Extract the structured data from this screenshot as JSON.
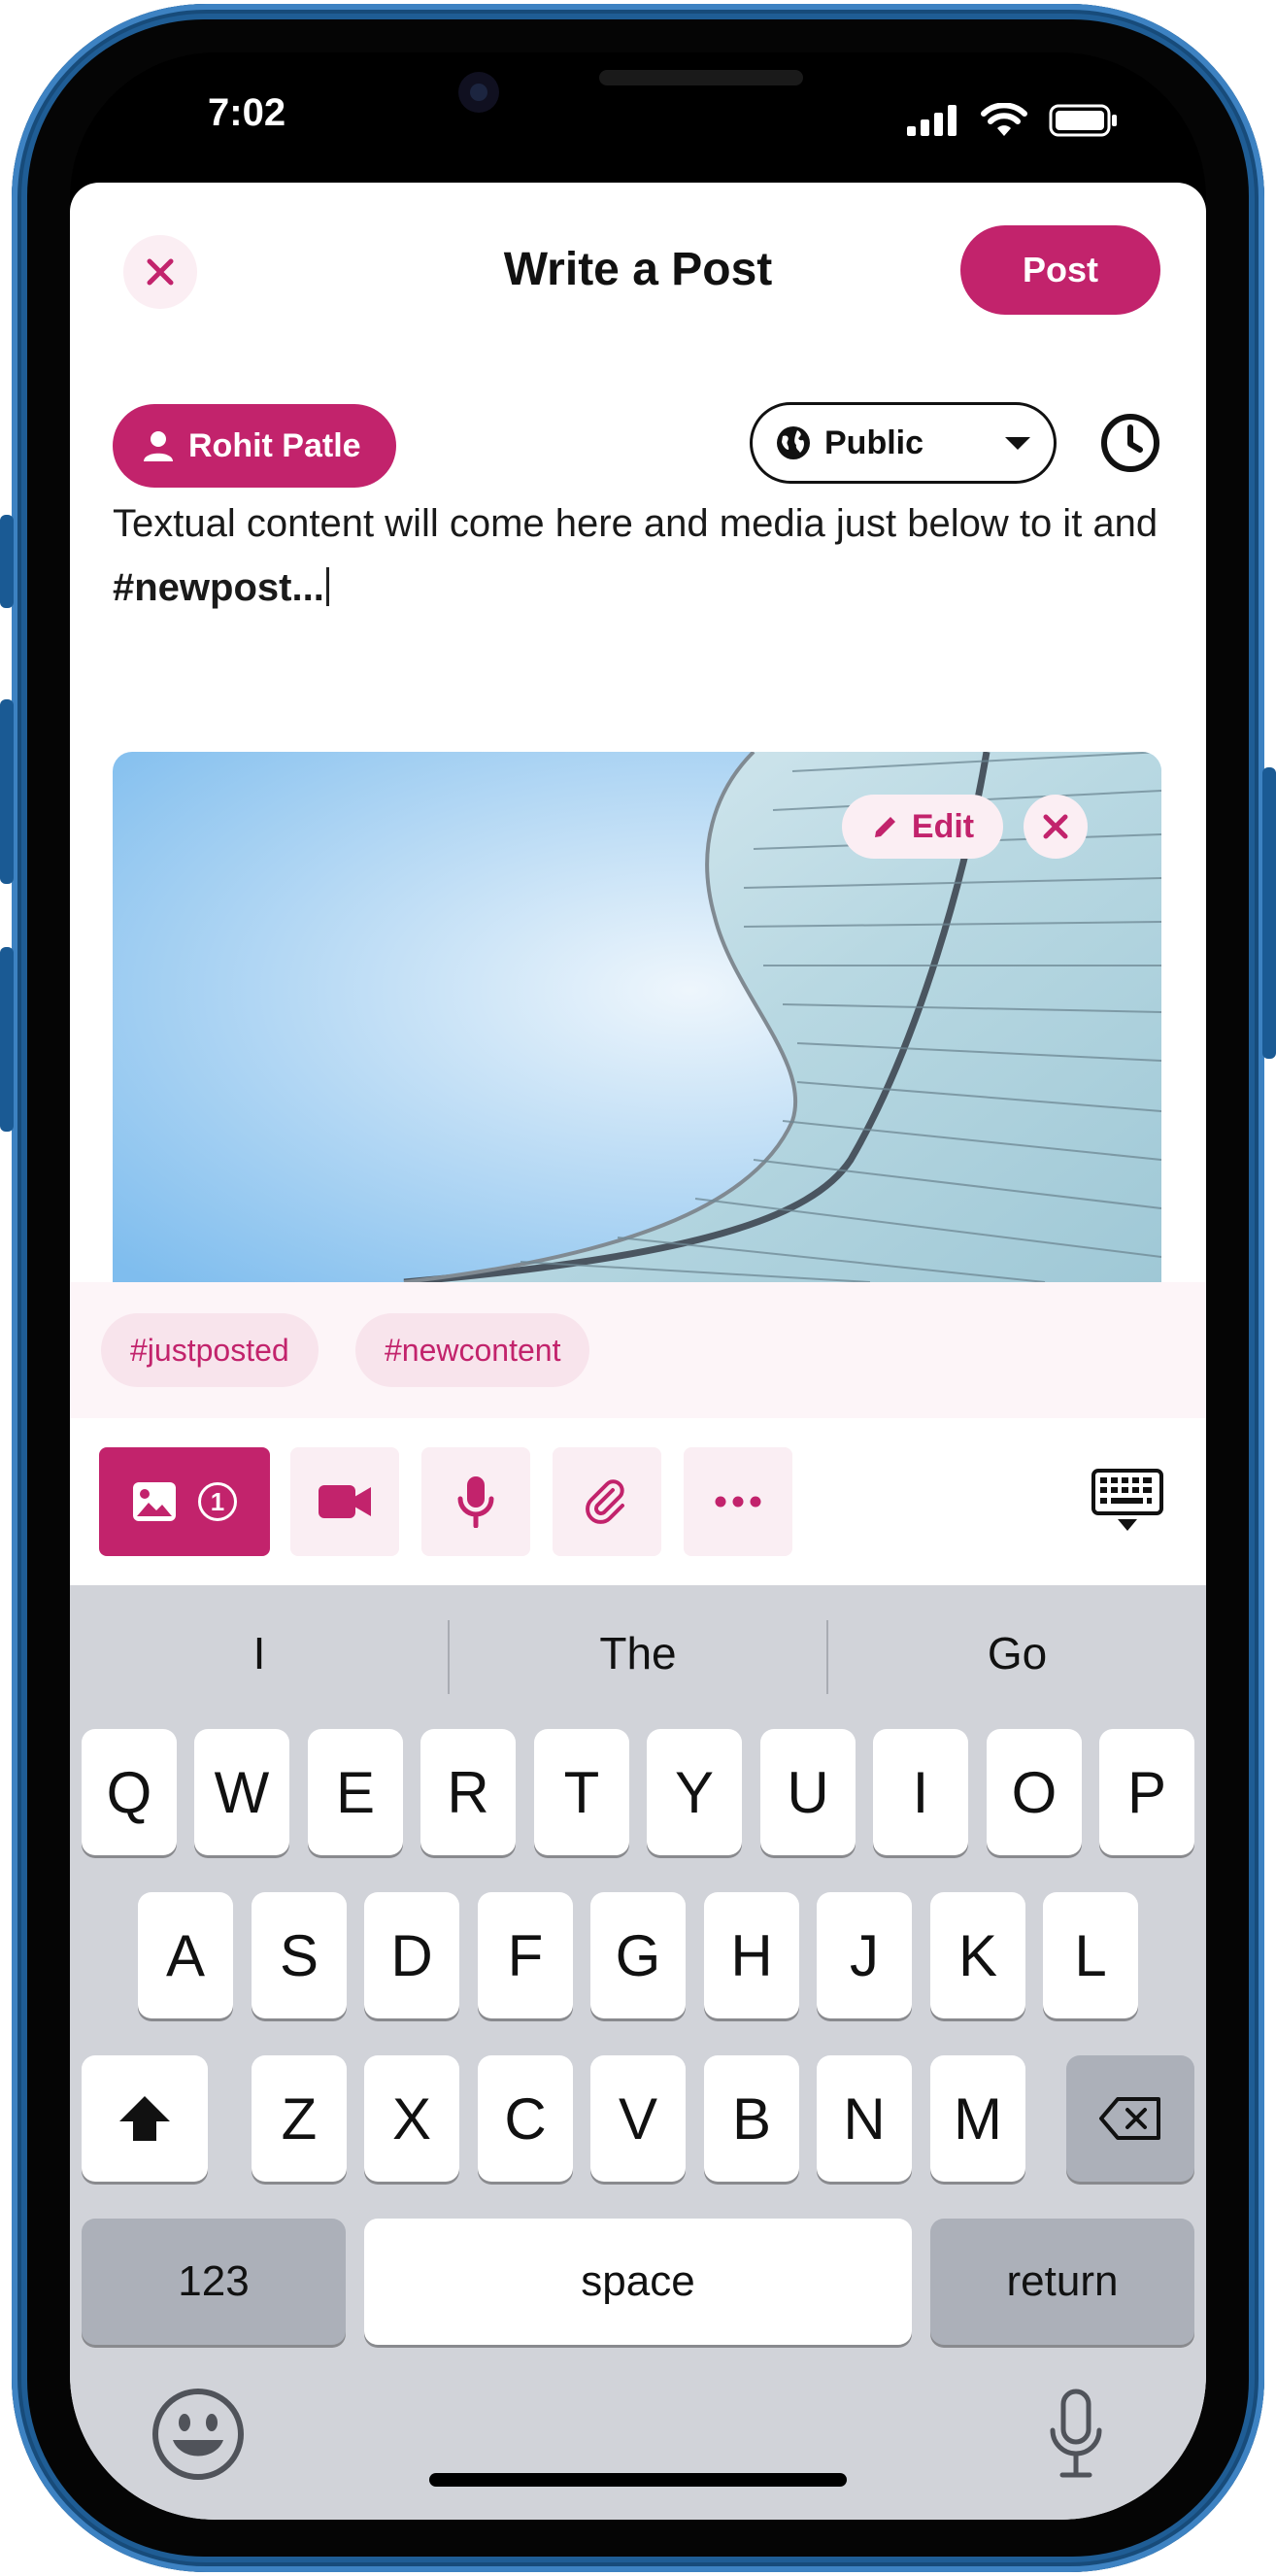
{
  "status_bar": {
    "time": "7:02"
  },
  "header": {
    "title": "Write a Post",
    "post_label": "Post"
  },
  "composer": {
    "author_name": "Rohit Patle",
    "visibility": "Public",
    "text_plain": "Textual content will come here and media just below to it and ",
    "text_hashtag": "#newpost..."
  },
  "media": {
    "edit_label": "Edit"
  },
  "hashtags": [
    "#justposted",
    "#newcontent"
  ],
  "toolbar": {
    "image_count": "1"
  },
  "keyboard": {
    "suggestions": [
      "I",
      "The",
      "Go"
    ],
    "row1": [
      "Q",
      "W",
      "E",
      "R",
      "T",
      "Y",
      "U",
      "I",
      "O",
      "P"
    ],
    "row2": [
      "A",
      "S",
      "D",
      "F",
      "G",
      "H",
      "J",
      "K",
      "L"
    ],
    "row3": [
      "Z",
      "X",
      "C",
      "V",
      "B",
      "N",
      "M"
    ],
    "numbers_label": "123",
    "space_label": "space",
    "return_label": "return"
  },
  "colors": {
    "accent": "#c2236c",
    "accent_soft": "#fbeef3",
    "keyboard_bg": "#d1d3d9"
  }
}
